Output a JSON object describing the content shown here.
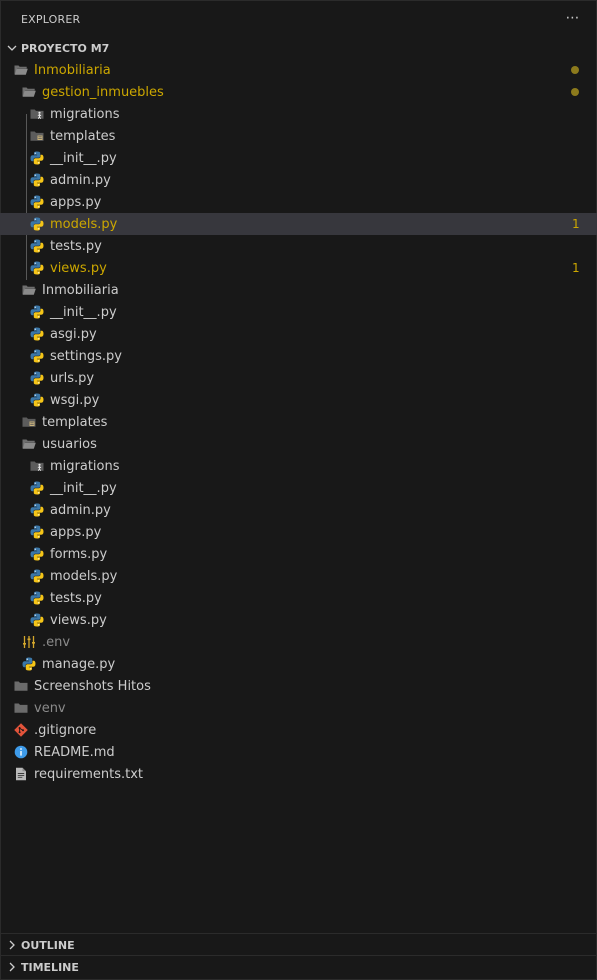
{
  "explorer": {
    "title": "EXPLORER",
    "more_icon": "ellipsis-icon"
  },
  "project": {
    "name": "PROYECTO M7"
  },
  "tree": [
    {
      "label": "Inmobiliaria",
      "icon": "folder-open-icon",
      "depth": 0,
      "status": "modified-dot",
      "tone": "mod"
    },
    {
      "label": "gestion_inmuebles",
      "icon": "folder-open-icon",
      "depth": 1,
      "status": "modified-dot",
      "tone": "mod"
    },
    {
      "label": "migrations",
      "icon": "folder-migrations-icon",
      "depth": 2
    },
    {
      "label": "templates",
      "icon": "folder-templates-icon",
      "depth": 2
    },
    {
      "label": "__init__.py",
      "icon": "python-file-icon",
      "depth": 2
    },
    {
      "label": "admin.py",
      "icon": "python-file-icon",
      "depth": 2
    },
    {
      "label": "apps.py",
      "icon": "python-file-icon",
      "depth": 2
    },
    {
      "label": "models.py",
      "icon": "python-file-icon",
      "depth": 2,
      "badge": "1",
      "tone": "mod",
      "selected": true
    },
    {
      "label": "tests.py",
      "icon": "python-file-icon",
      "depth": 2
    },
    {
      "label": "views.py",
      "icon": "python-file-icon",
      "depth": 2,
      "badge": "1",
      "tone": "mod"
    },
    {
      "label": "Inmobiliaria",
      "icon": "folder-open-icon",
      "depth": 1
    },
    {
      "label": "__init__.py",
      "icon": "python-file-icon",
      "depth": 2
    },
    {
      "label": "asgi.py",
      "icon": "python-file-icon",
      "depth": 2
    },
    {
      "label": "settings.py",
      "icon": "python-file-icon",
      "depth": 2
    },
    {
      "label": "urls.py",
      "icon": "python-file-icon",
      "depth": 2
    },
    {
      "label": "wsgi.py",
      "icon": "python-file-icon",
      "depth": 2
    },
    {
      "label": "templates",
      "icon": "folder-templates-icon",
      "depth": 1
    },
    {
      "label": "usuarios",
      "icon": "folder-open-icon",
      "depth": 1
    },
    {
      "label": "migrations",
      "icon": "folder-migrations-icon",
      "depth": 2
    },
    {
      "label": "__init__.py",
      "icon": "python-file-icon",
      "depth": 2
    },
    {
      "label": "admin.py",
      "icon": "python-file-icon",
      "depth": 2
    },
    {
      "label": "apps.py",
      "icon": "python-file-icon",
      "depth": 2
    },
    {
      "label": "forms.py",
      "icon": "python-file-icon",
      "depth": 2
    },
    {
      "label": "models.py",
      "icon": "python-file-icon",
      "depth": 2
    },
    {
      "label": "tests.py",
      "icon": "python-file-icon",
      "depth": 2
    },
    {
      "label": "views.py",
      "icon": "python-file-icon",
      "depth": 2
    },
    {
      "label": ".env",
      "icon": "env-settings-icon",
      "depth": 1,
      "tone": "dim"
    },
    {
      "label": "manage.py",
      "icon": "python-file-icon",
      "depth": 1
    },
    {
      "label": "Screenshots Hitos",
      "icon": "folder-icon",
      "depth": 0
    },
    {
      "label": "venv",
      "icon": "folder-icon",
      "depth": 0,
      "tone": "dim"
    },
    {
      "label": ".gitignore",
      "icon": "git-icon",
      "depth": 0
    },
    {
      "label": "README.md",
      "icon": "info-icon",
      "depth": 0
    },
    {
      "label": "requirements.txt",
      "icon": "text-file-icon",
      "depth": 0
    }
  ],
  "outline": {
    "label": "OUTLINE"
  },
  "timeline": {
    "label": "TIMELINE"
  },
  "colors": {
    "background": "#181818",
    "text": "#cccccc",
    "modified": "#cca700",
    "selected_row": "#37373d",
    "python_blue": "#3b77a8",
    "python_yellow": "#f5c518"
  }
}
